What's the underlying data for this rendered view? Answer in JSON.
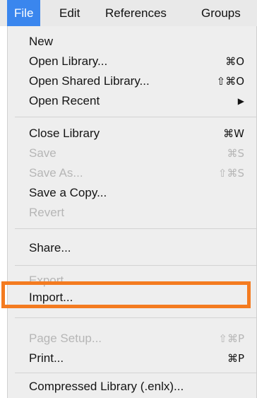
{
  "menubar": {
    "items": [
      {
        "label": "File",
        "active": true
      },
      {
        "label": "Edit"
      },
      {
        "label": "References"
      },
      {
        "label": "Groups"
      }
    ]
  },
  "menu": {
    "items": [
      {
        "label": "New",
        "shortcut": "",
        "enabled": true
      },
      {
        "label": "Open Library...",
        "shortcut": "⌘O",
        "enabled": true
      },
      {
        "label": "Open Shared Library...",
        "shortcut": "⇧⌘O",
        "enabled": true
      },
      {
        "label": "Open Recent",
        "shortcut": "▶",
        "enabled": true
      },
      {
        "label": "Close Library",
        "shortcut": "⌘W",
        "enabled": true
      },
      {
        "label": "Save",
        "shortcut": "⌘S",
        "enabled": false
      },
      {
        "label": "Save As...",
        "shortcut": "⇧⌘S",
        "enabled": false
      },
      {
        "label": "Save a Copy...",
        "shortcut": "",
        "enabled": true
      },
      {
        "label": "Revert",
        "shortcut": "",
        "enabled": false
      },
      {
        "label": "Share...",
        "shortcut": "",
        "enabled": true
      },
      {
        "label": "Export",
        "shortcut": "",
        "enabled": false
      },
      {
        "label": "Import...",
        "shortcut": "",
        "enabled": true,
        "highlighted": true
      },
      {
        "label": "Page Setup...",
        "shortcut": "⇧⌘P",
        "enabled": false
      },
      {
        "label": "Print...",
        "shortcut": "⌘P",
        "enabled": true
      },
      {
        "label": "Compressed Library (.enlx)...",
        "shortcut": "",
        "enabled": true
      }
    ]
  },
  "colors": {
    "menubar_bg": "#e9e9e9",
    "active_bg": "#3a86ee",
    "menu_bg": "#eeeeee",
    "disabled_text": "#b6b6b6",
    "highlight_border": "#f47b20"
  }
}
